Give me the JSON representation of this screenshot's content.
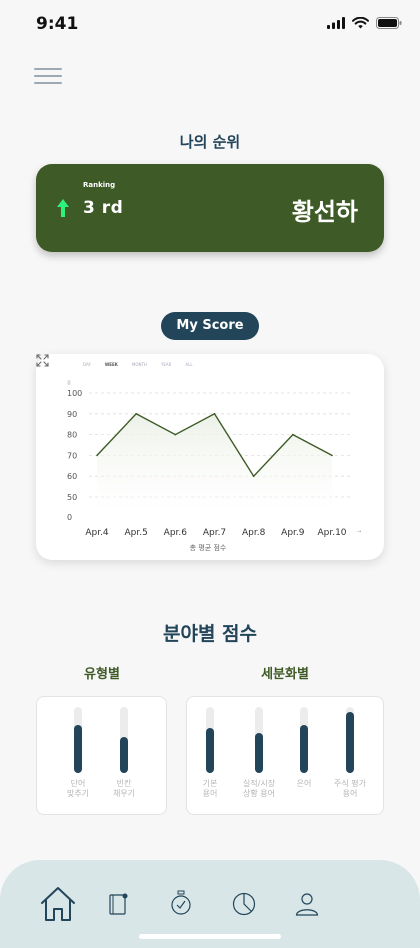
{
  "status": {
    "time": "9:41"
  },
  "ranking": {
    "title": "나의 순위",
    "label": "Ranking",
    "value": "3 rd",
    "name": "황선하"
  },
  "score": {
    "pill_label": "My Score",
    "tabs": [
      "DAY",
      "WEEK",
      "MONTH",
      "YEAR",
      "ALL"
    ],
    "active_tab": "WEEK",
    "xlabel": "총 평균 점수",
    "ylabel_unit": "점"
  },
  "chart_data": {
    "type": "area",
    "categories": [
      "Apr.4",
      "Apr.5",
      "Apr.6",
      "Apr.7",
      "Apr.8",
      "Apr.9",
      "Apr.10"
    ],
    "values": [
      70,
      90,
      80,
      90,
      60,
      80,
      70
    ],
    "ylim": [
      0,
      100
    ],
    "yticks": [
      0,
      50,
      60,
      70,
      80,
      90,
      100
    ],
    "xlabel": "총 평균 점수",
    "ylabel": "",
    "grid": true,
    "colors": {
      "line": "#3e5a26",
      "fill": "#e9efe4"
    }
  },
  "category": {
    "title": "분야별 점수",
    "type_title": "유형별",
    "detail_title": "세분화별",
    "type_bars": [
      {
        "label": "단어\n맞추기",
        "value": 0.72
      },
      {
        "label": "빈칸\n채우기",
        "value": 0.55
      }
    ],
    "detail_bars": [
      {
        "label": "기본\n용어",
        "value": 0.68
      },
      {
        "label": "실적/시장\n상황 용어",
        "value": 0.6
      },
      {
        "label": "은어",
        "value": 0.72
      },
      {
        "label": "주식 평가\n용어",
        "value": 0.93
      }
    ]
  },
  "nav": {
    "items": [
      "home-icon",
      "notebook-icon",
      "timer-icon",
      "pie-chart-icon",
      "profile-icon"
    ],
    "active": "home-icon"
  }
}
